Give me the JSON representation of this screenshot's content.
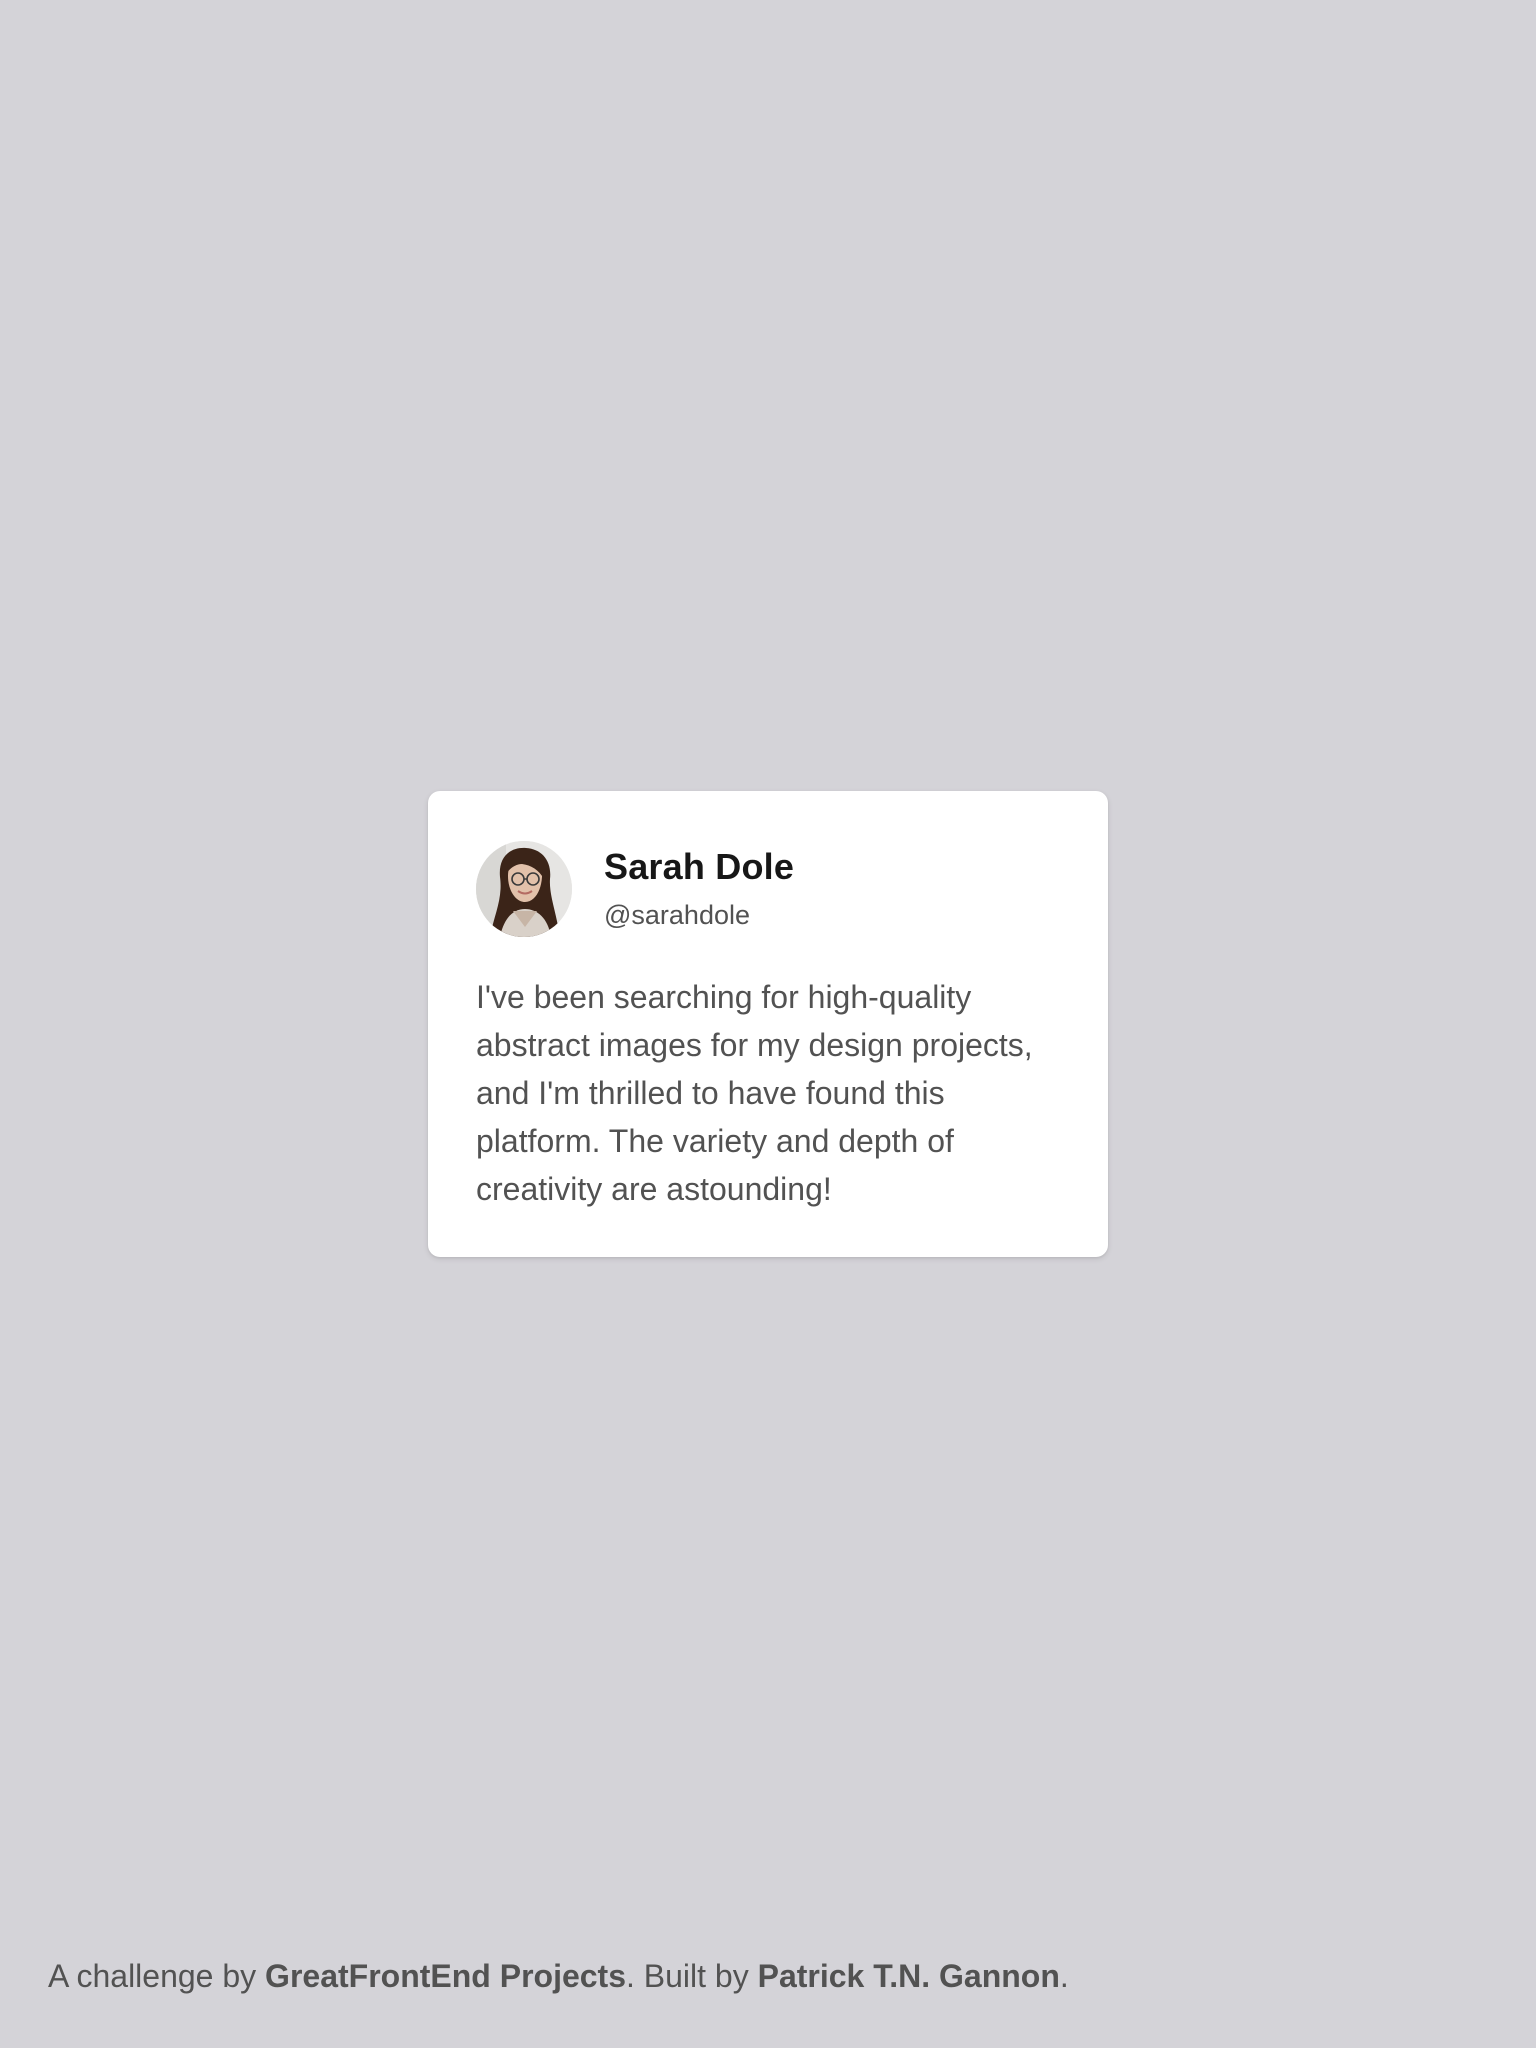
{
  "testimonial": {
    "name": "Sarah Dole",
    "handle": "@sarahdole",
    "quote": "I've been searching for high-quality abstract images for my design projects, and I'm thrilled to have found this platform. The variety and depth of creativity are astounding!",
    "avatar_icon": "profile-photo-avatar"
  },
  "footer": {
    "prefix": "A challenge by ",
    "challenge_link": "GreatFrontEnd Projects",
    "middle": ". Built by ",
    "author_link": "Patrick T.N. Gannon",
    "suffix": "."
  },
  "colors": {
    "background": "#d4d3d8",
    "card": "#ffffff",
    "name": "#171717",
    "text": "#525252"
  }
}
